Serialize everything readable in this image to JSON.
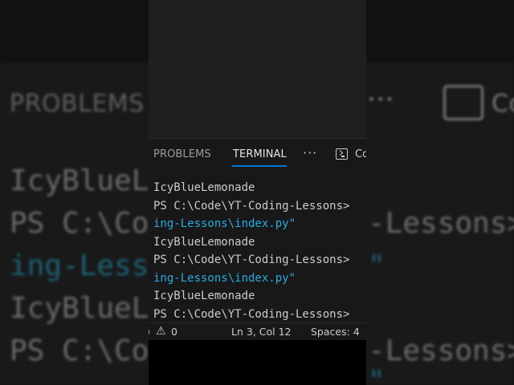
{
  "panel": {
    "tabs": {
      "problems": "PROBLEMS",
      "terminal": "TERMINAL",
      "more": "···",
      "cut_label": "Co"
    }
  },
  "terminal": {
    "lines": [
      {
        "text": "IcyBlueLemonade",
        "kind": "output"
      },
      {
        "text": "PS C:\\Code\\YT-Coding-Lessons>",
        "kind": "prompt"
      },
      {
        "text": "ing-Lessons\\index.py\"",
        "kind": "path"
      },
      {
        "text": "IcyBlueLemonade",
        "kind": "output"
      },
      {
        "text": "PS C:\\Code\\YT-Coding-Lessons>",
        "kind": "prompt"
      },
      {
        "text": "ing-Lessons\\index.py\"",
        "kind": "path"
      },
      {
        "text": "IcyBlueLemonade",
        "kind": "output"
      },
      {
        "text": "PS C:\\Code\\YT-Coding-Lessons>",
        "kind": "prompt"
      }
    ]
  },
  "statusbar": {
    "edge": ")",
    "warnings": "0",
    "position": "Ln 3, Col 12",
    "spaces": "Spaces: 4"
  },
  "background": {
    "tab_label": "PROBLEMS",
    "dots": "···",
    "cut_label": "Co",
    "lines": [
      {
        "text": "IcyBlueL",
        "kind": "output"
      },
      {
        "text": "PS C:\\Co",
        "kind": "prompt"
      },
      {
        "text": "ing-Less",
        "kind": "path"
      },
      {
        "text": "IcyBlueL",
        "kind": "output"
      },
      {
        "text": "PS C:\\Co",
        "kind": "prompt"
      }
    ],
    "right_lines": [
      "-Lessons>",
      "\"",
      "-Lessons>",
      "\""
    ]
  },
  "colors": {
    "accent": "#0078d4",
    "path_text": "#2aaae0",
    "terminal_bg": "#181818"
  }
}
